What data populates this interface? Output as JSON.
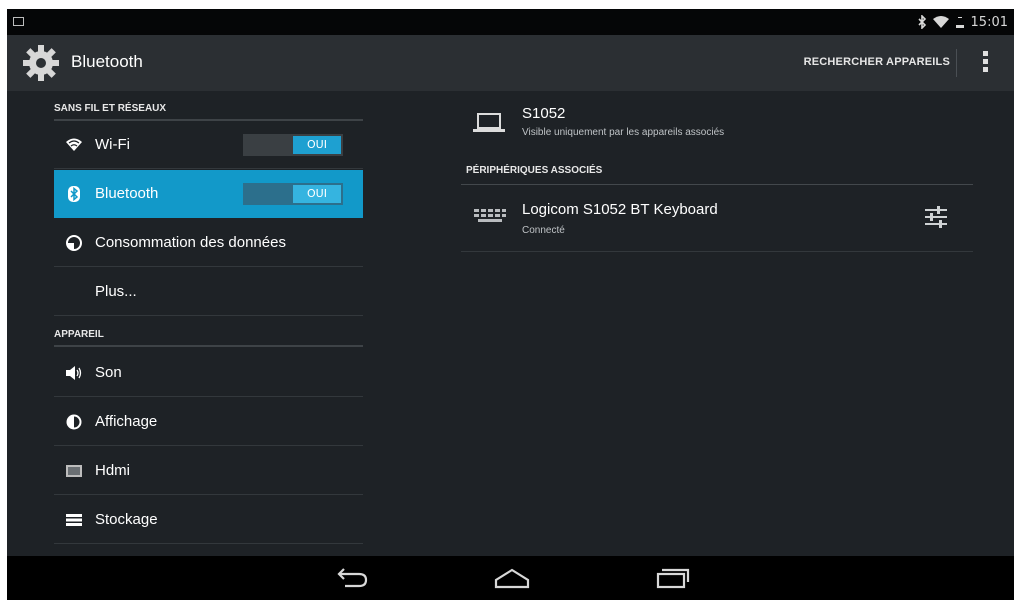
{
  "status_bar": {
    "time": "15:01",
    "icons": [
      "bluetooth-icon",
      "wifi-icon",
      "battery-icon"
    ]
  },
  "action_bar": {
    "title": "Bluetooth",
    "search_label": "RECHERCHER APPAREILS",
    "icons": [
      "settings-gear-icon",
      "overflow-menu-icon"
    ]
  },
  "sidebar": {
    "section_wireless": "SANS FIL ET RÉSEAUX",
    "section_device": "APPAREIL",
    "items": [
      {
        "label": "Wi-Fi",
        "icon": "wifi-icon",
        "toggle": "OUI",
        "active": false
      },
      {
        "label": "Bluetooth",
        "icon": "bluetooth-icon",
        "toggle": "OUI",
        "active": true
      },
      {
        "label": "Consommation des données",
        "icon": "data-usage-icon"
      },
      {
        "label": "Plus..."
      },
      {
        "label": "Son",
        "icon": "speaker-icon"
      },
      {
        "label": "Affichage",
        "icon": "brightness-icon"
      },
      {
        "label": "Hdmi",
        "icon": "hdmi-icon"
      },
      {
        "label": "Stockage",
        "icon": "storage-icon"
      }
    ]
  },
  "detail": {
    "this_device": {
      "name": "S1052",
      "subtitle": "Visible uniquement par les appareils associés",
      "icon": "laptop-icon"
    },
    "paired_header": "PÉRIPHÉRIQUES ASSOCIÉS",
    "paired_devices": [
      {
        "name": "Logicom S1052 BT Keyboard",
        "status": "Connecté",
        "icon": "keyboard-icon",
        "action_icon": "device-settings-icon"
      }
    ]
  },
  "nav_bar": {
    "icons": [
      "back-icon",
      "home-icon",
      "recent-apps-icon"
    ]
  },
  "colors": {
    "accent": "#1299c9",
    "background": "#1e2226",
    "action_bar": "#2b2f33"
  }
}
